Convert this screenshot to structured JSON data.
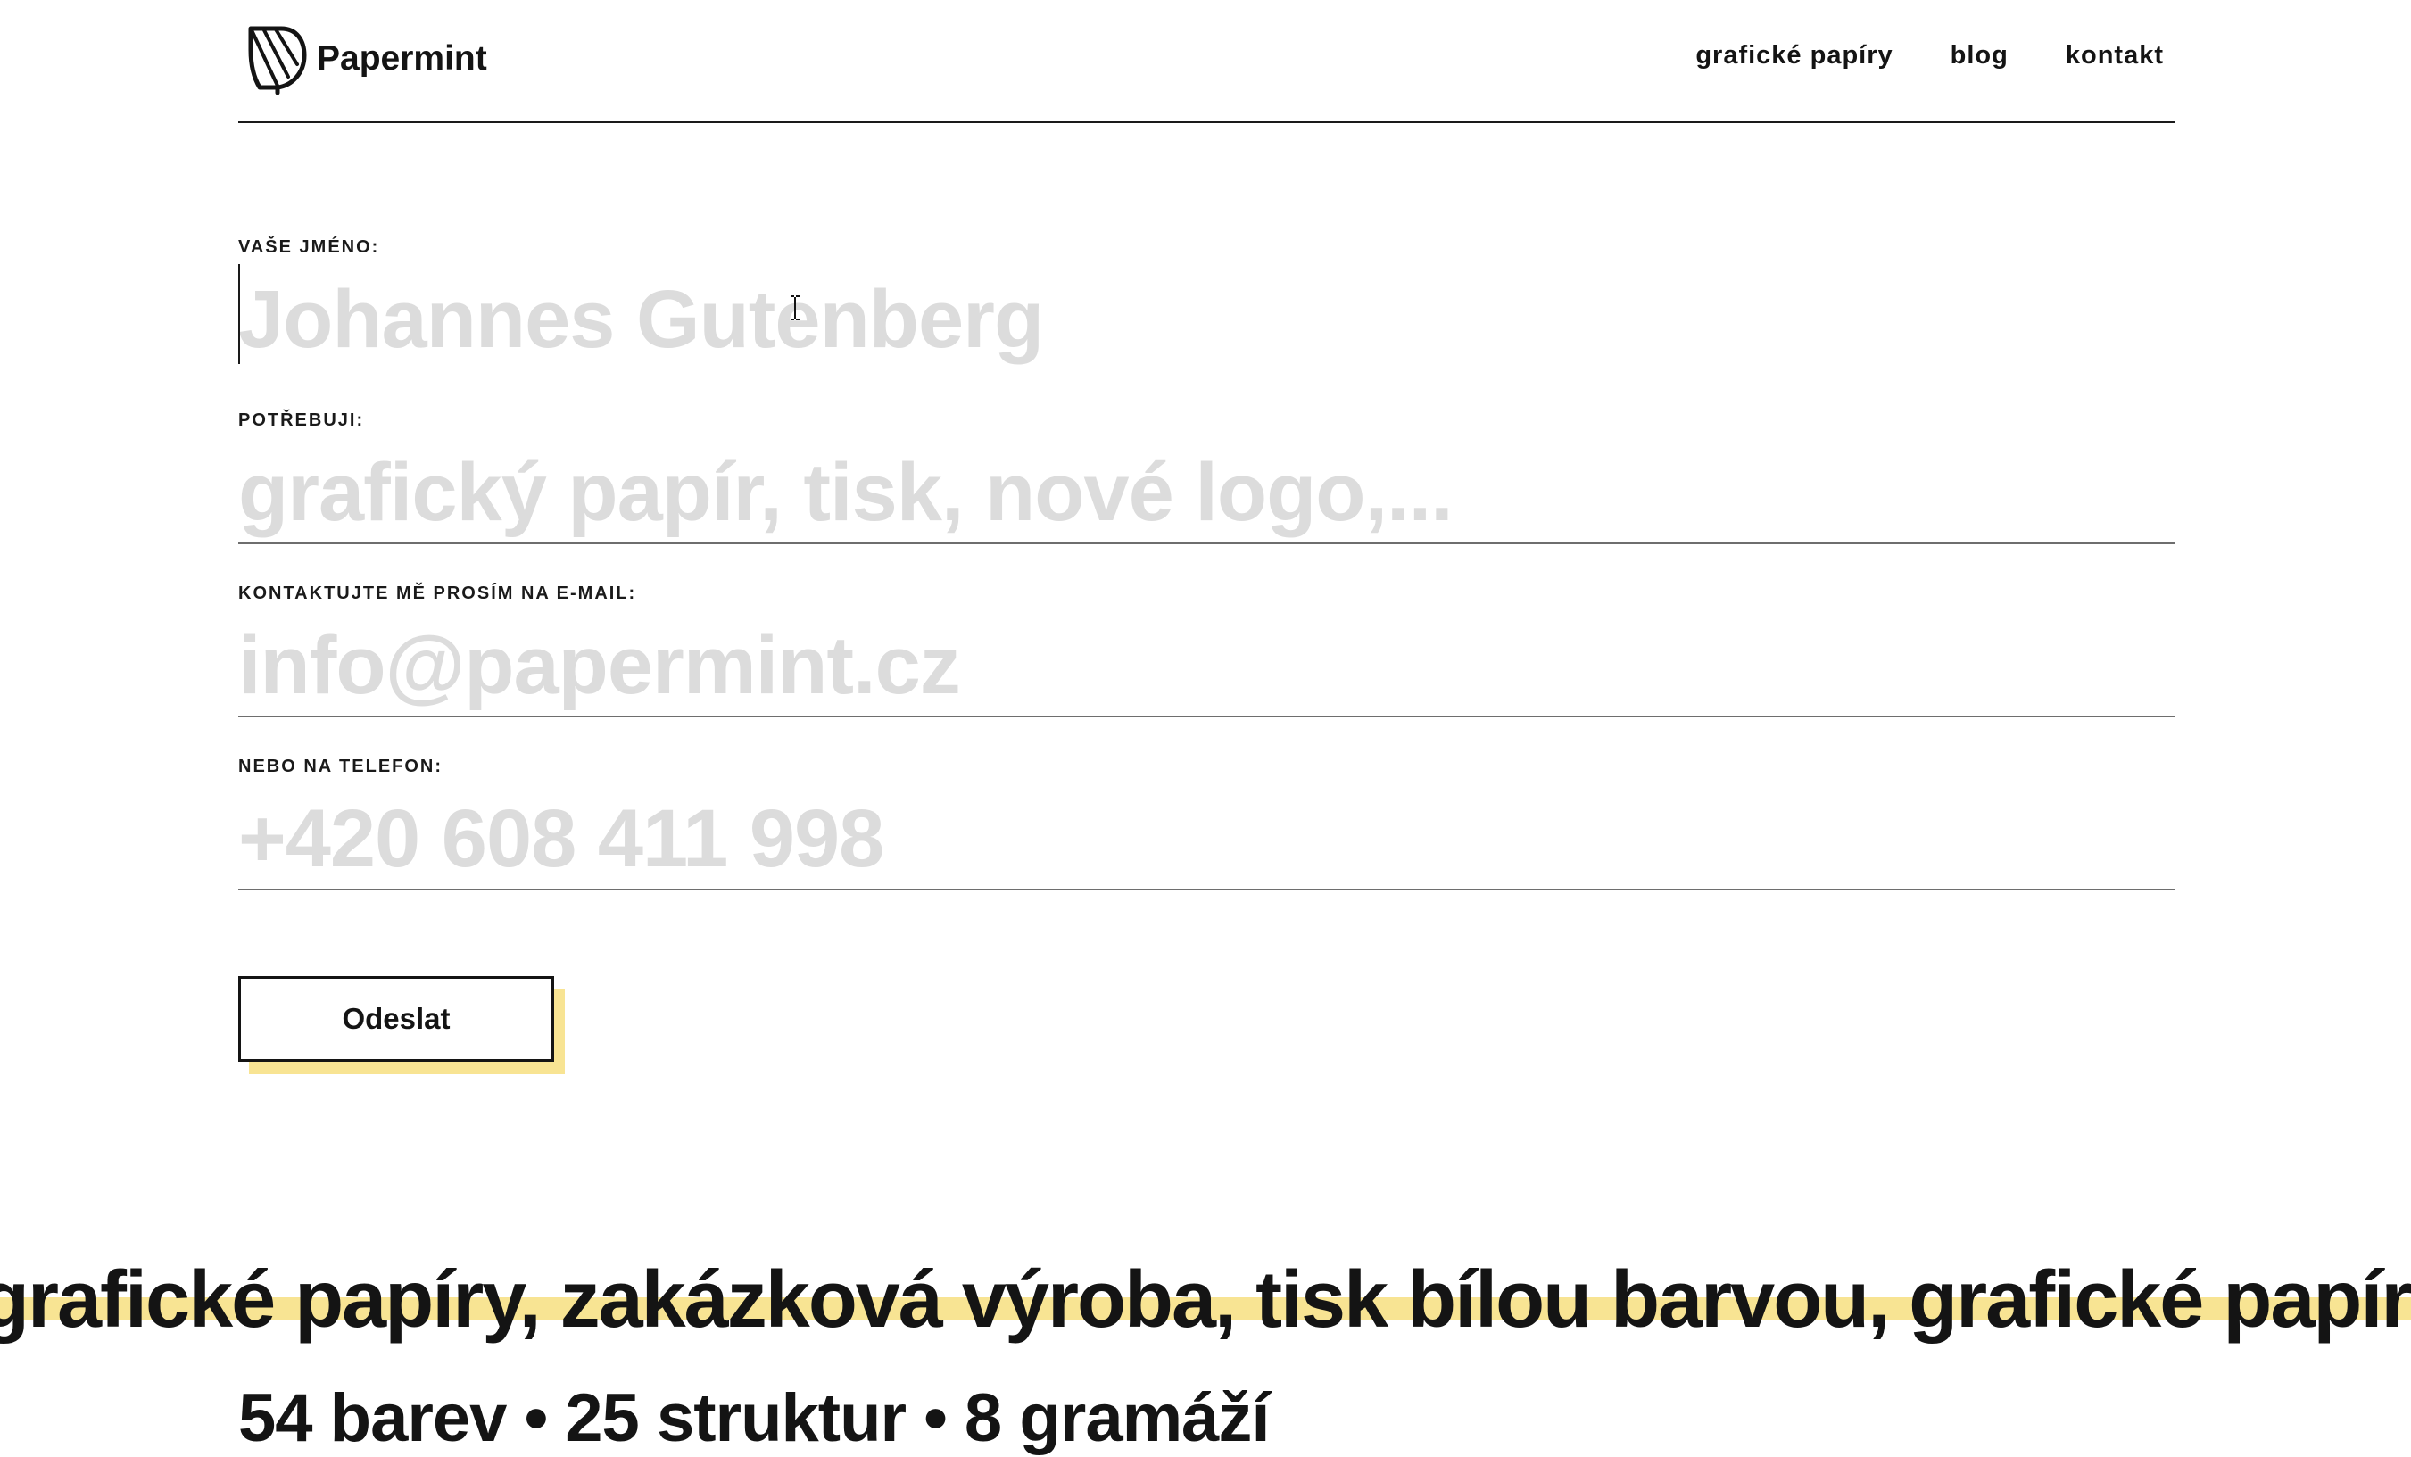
{
  "header": {
    "logo_text": "Papermint",
    "logo_icon": "leaf-icon",
    "nav": [
      {
        "label": "grafické papíry"
      },
      {
        "label": "blog"
      },
      {
        "label": "kontakt"
      }
    ]
  },
  "form": {
    "name": {
      "label": "VAŠE JMÉNO:",
      "placeholder": "Johannes Gutenberg",
      "value": ""
    },
    "need": {
      "label": "POTŘEBUJI:",
      "placeholder": "grafický papír, tisk, nové logo,...",
      "value": ""
    },
    "email": {
      "label": "KONTAKTUJTE MĚ PROSÍM NA E-MAIL:",
      "placeholder": "info@papermint.cz",
      "value": ""
    },
    "phone": {
      "label": "NEBO NA TELEFON:",
      "placeholder": "+420 608 411 998",
      "value": ""
    },
    "submit_label": "Odeslat"
  },
  "marquee": {
    "text": "grafické papíry, zakázková výroba, tisk bílou barvou, grafické papíry, zakázková výroba"
  },
  "stats": {
    "text": "54 barev • 25 struktur • 8 gramáží"
  },
  "colors": {
    "accent_yellow": "#f8e493",
    "text_dark": "#141414",
    "placeholder_gray": "#dcdcdc"
  }
}
